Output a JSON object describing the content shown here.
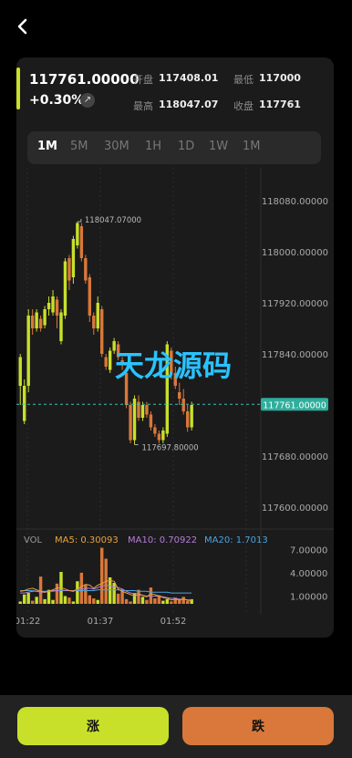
{
  "header": {
    "back_icon": "chevron-left-icon"
  },
  "summary": {
    "price": "117761.00000",
    "change": "+0.30%",
    "change_icon": "arrow-up-right-icon",
    "stats": [
      {
        "label": "开盘",
        "value": "117408.01"
      },
      {
        "label": "最低",
        "value": "117000"
      },
      {
        "label": "最高",
        "value": "118047.07"
      },
      {
        "label": "收盘",
        "value": "117761"
      }
    ]
  },
  "tabs": [
    {
      "label": "1M",
      "active": true
    },
    {
      "label": "5M",
      "active": false
    },
    {
      "label": "30M",
      "active": false
    },
    {
      "label": "1H",
      "active": false
    },
    {
      "label": "1D",
      "active": false
    },
    {
      "label": "1W",
      "active": false
    },
    {
      "label": "1M",
      "active": false
    }
  ],
  "watermark": "天龙源码",
  "colors": {
    "up": "#c8e02a",
    "down": "#d9783a",
    "background": "#1b1b1b",
    "accent": "#c8e02a"
  },
  "chart_data": {
    "type": "candlestick",
    "y_ticks": [
      "118080.00000",
      "118000.00000",
      "117920.00000",
      "117840.00000",
      "117680.00000",
      "117600.00000"
    ],
    "ylim": [
      117580,
      118120
    ],
    "current_price_label": "117761.00000",
    "current_price": 117761,
    "high_marker": "118047.07000",
    "high_value": 118047.07,
    "low_marker": "117697.80000",
    "low_value": 117697.8,
    "x_ticks": [
      "01:22",
      "01:37",
      "01:52"
    ],
    "candles": [
      [
        117790,
        117835,
        117760,
        117840,
        "up"
      ],
      [
        117735,
        117790,
        117730,
        117800,
        "up"
      ],
      [
        117790,
        117900,
        117780,
        117910,
        "up"
      ],
      [
        117900,
        117880,
        117870,
        117910,
        "down"
      ],
      [
        117880,
        117905,
        117875,
        117910,
        "up"
      ],
      [
        117895,
        117880,
        117875,
        117900,
        "down"
      ],
      [
        117885,
        117910,
        117880,
        117915,
        "up"
      ],
      [
        117910,
        117920,
        117900,
        117930,
        "up"
      ],
      [
        117905,
        117930,
        117900,
        117940,
        "up"
      ],
      [
        117925,
        117900,
        117880,
        117930,
        "down"
      ],
      [
        117860,
        117905,
        117855,
        117910,
        "up"
      ],
      [
        117900,
        117985,
        117895,
        117990,
        "up"
      ],
      [
        117990,
        117955,
        117940,
        117995,
        "down"
      ],
      [
        117960,
        118020,
        117950,
        118025,
        "up"
      ],
      [
        118010,
        118045,
        118005,
        118047,
        "up"
      ],
      [
        118040,
        117990,
        117985,
        118045,
        "down"
      ],
      [
        117990,
        117955,
        117950,
        117995,
        "down"
      ],
      [
        117960,
        117900,
        117890,
        117965,
        "down"
      ],
      [
        117900,
        117880,
        117870,
        117905,
        "down"
      ],
      [
        117880,
        117920,
        117875,
        117930,
        "up"
      ],
      [
        117910,
        117840,
        117835,
        117915,
        "down"
      ],
      [
        117835,
        117820,
        117815,
        117840,
        "down"
      ],
      [
        117815,
        117845,
        117810,
        117850,
        "up"
      ],
      [
        117845,
        117860,
        117840,
        117865,
        "up"
      ],
      [
        117855,
        117835,
        117830,
        117860,
        "down"
      ],
      [
        117830,
        117825,
        117815,
        117835,
        "down"
      ],
      [
        117810,
        117760,
        117755,
        117815,
        "down"
      ],
      [
        117760,
        117705,
        117700,
        117765,
        "down"
      ],
      [
        117705,
        117770,
        117698,
        117775,
        "up"
      ],
      [
        117765,
        117740,
        117735,
        117775,
        "down"
      ],
      [
        117740,
        117760,
        117735,
        117765,
        "up"
      ],
      [
        117760,
        117745,
        117740,
        117765,
        "down"
      ],
      [
        117745,
        117725,
        117720,
        117750,
        "down"
      ],
      [
        117725,
        117715,
        117710,
        117730,
        "down"
      ],
      [
        117715,
        117705,
        117700,
        117720,
        "down"
      ],
      [
        117705,
        117720,
        117700,
        117725,
        "up"
      ],
      [
        117715,
        117855,
        117710,
        117860,
        "up"
      ],
      [
        117845,
        117810,
        117800,
        117850,
        "down"
      ],
      [
        117810,
        117790,
        117785,
        117820,
        "down"
      ],
      [
        117780,
        117770,
        117760,
        117795,
        "down"
      ],
      [
        117770,
        117750,
        117745,
        117785,
        "down"
      ],
      [
        117750,
        117725,
        117718,
        117760,
        "down"
      ],
      [
        117725,
        117760,
        117720,
        117765,
        "up"
      ]
    ],
    "volume_indicator": {
      "label": "VOL",
      "ma5_label": "MA5: 0.30093",
      "ma10_label": "MA10: 0.70922",
      "ma20_label": "MA20: 1.7013",
      "ma5_color": "#e8a33a",
      "ma10_color": "#b57dd8",
      "ma20_color": "#4aa3e0",
      "y_ticks": [
        "7.00000",
        "4.00000",
        "1.00000"
      ],
      "ylim": [
        0,
        7.5
      ],
      "volumes": [
        0.3,
        1.2,
        1.4,
        0.4,
        0.9,
        3.5,
        0.6,
        1.8,
        0.5,
        2.6,
        4.1,
        1.0,
        0.8,
        0.3,
        2.9,
        4.0,
        2.4,
        1.1,
        0.7,
        0.5,
        7.2,
        5.8,
        3.4,
        2.7,
        1.3,
        1.9,
        0.6,
        0.3,
        1.4,
        1.8,
        0.9,
        0.5,
        2.1,
        0.7,
        1.1,
        0.4,
        0.6,
        0.3,
        0.8,
        0.5,
        0.9,
        0.4,
        0.6
      ],
      "ma5": [
        1.6,
        1.7,
        1.9,
        2.0,
        1.8,
        1.6,
        1.5,
        1.6,
        1.8,
        2.0,
        2.1,
        1.9,
        1.7,
        1.6,
        1.9,
        2.2,
        2.5,
        2.4,
        2.0,
        2.4,
        2.6,
        2.9,
        3.0,
        2.9,
        1.9,
        1.6,
        1.4,
        1.2,
        1.0,
        1.2,
        1.1,
        0.9,
        1.3,
        1.2,
        1.0,
        0.8,
        0.7,
        0.5,
        0.6,
        0.5,
        0.6,
        0.5,
        0.4
      ],
      "ma10": [
        1.4,
        1.4,
        1.5,
        1.6,
        1.6,
        1.5,
        1.5,
        1.6,
        1.7,
        1.7,
        1.8,
        1.7,
        1.7,
        1.7,
        1.8,
        1.9,
        2.0,
        2.0,
        1.9,
        2.1,
        2.3,
        2.4,
        2.3,
        2.2,
        2.1,
        1.9,
        1.6,
        1.4,
        1.3,
        1.3,
        1.1,
        1.0,
        1.0,
        1.0,
        1.0,
        0.9,
        0.8,
        0.7,
        0.7,
        0.6,
        0.6,
        0.5,
        0.5
      ],
      "ma20": [
        1.7,
        1.7,
        1.7,
        1.7,
        1.6,
        1.6,
        1.6,
        1.6,
        1.6,
        1.7,
        1.7,
        1.7,
        1.7,
        1.7,
        1.7,
        1.7,
        1.7,
        1.7,
        1.7,
        1.8,
        1.8,
        1.8,
        1.8,
        1.8,
        1.8,
        1.7,
        1.7,
        1.7,
        1.7,
        1.6,
        1.6,
        1.6,
        1.5,
        1.5,
        1.5,
        1.5,
        1.5,
        1.4,
        1.4,
        1.4,
        1.4,
        1.4,
        1.4
      ]
    }
  },
  "actions": {
    "rise_label": "涨",
    "fall_label": "跌"
  }
}
